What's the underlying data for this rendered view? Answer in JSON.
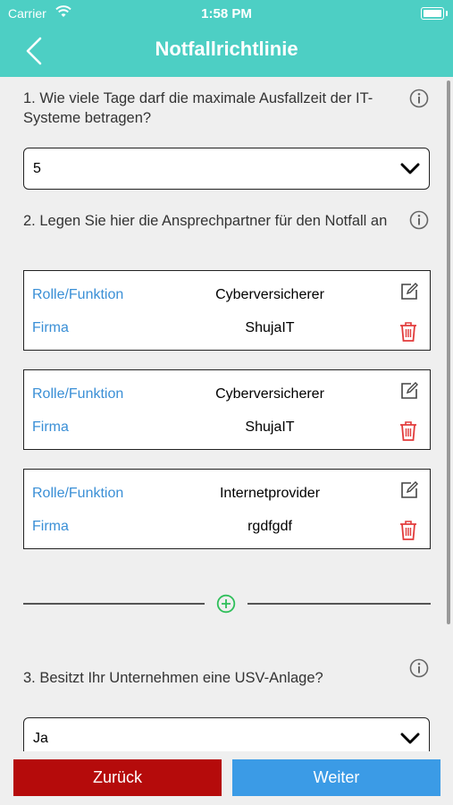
{
  "status": {
    "carrier": "Carrier",
    "time": "1:58 PM"
  },
  "header": {
    "title": "Notfallrichtlinie"
  },
  "q1": {
    "text": "1. Wie viele Tage darf die maximale Ausfallzeit der IT-Systeme betragen?",
    "value": "5"
  },
  "q2": {
    "text": "2. Legen Sie hier die Ansprechpartner für den Notfall an"
  },
  "contacts": [
    {
      "role_label": "Rolle/Funktion",
      "role": "Cyberversicherer",
      "company_label": "Firma",
      "company": "ShujaIT"
    },
    {
      "role_label": "Rolle/Funktion",
      "role": "Cyberversicherer",
      "company_label": "Firma",
      "company": "ShujaIT"
    },
    {
      "role_label": "Rolle/Funktion",
      "role": "Internetprovider",
      "company_label": "Firma",
      "company": "rgdfgdf"
    }
  ],
  "q3": {
    "text": "3. Besitzt Ihr Unternehmen eine USV-Anlage?",
    "value": "Ja"
  },
  "buttons": {
    "back": "Zurück",
    "next": "Weiter"
  },
  "colors": {
    "header": "#4dcfc4",
    "link": "#3a8fd6",
    "danger": "#e23b3b",
    "add": "#2fbf5a",
    "back_btn": "#b50b0b",
    "next_btn": "#3b9be6"
  }
}
